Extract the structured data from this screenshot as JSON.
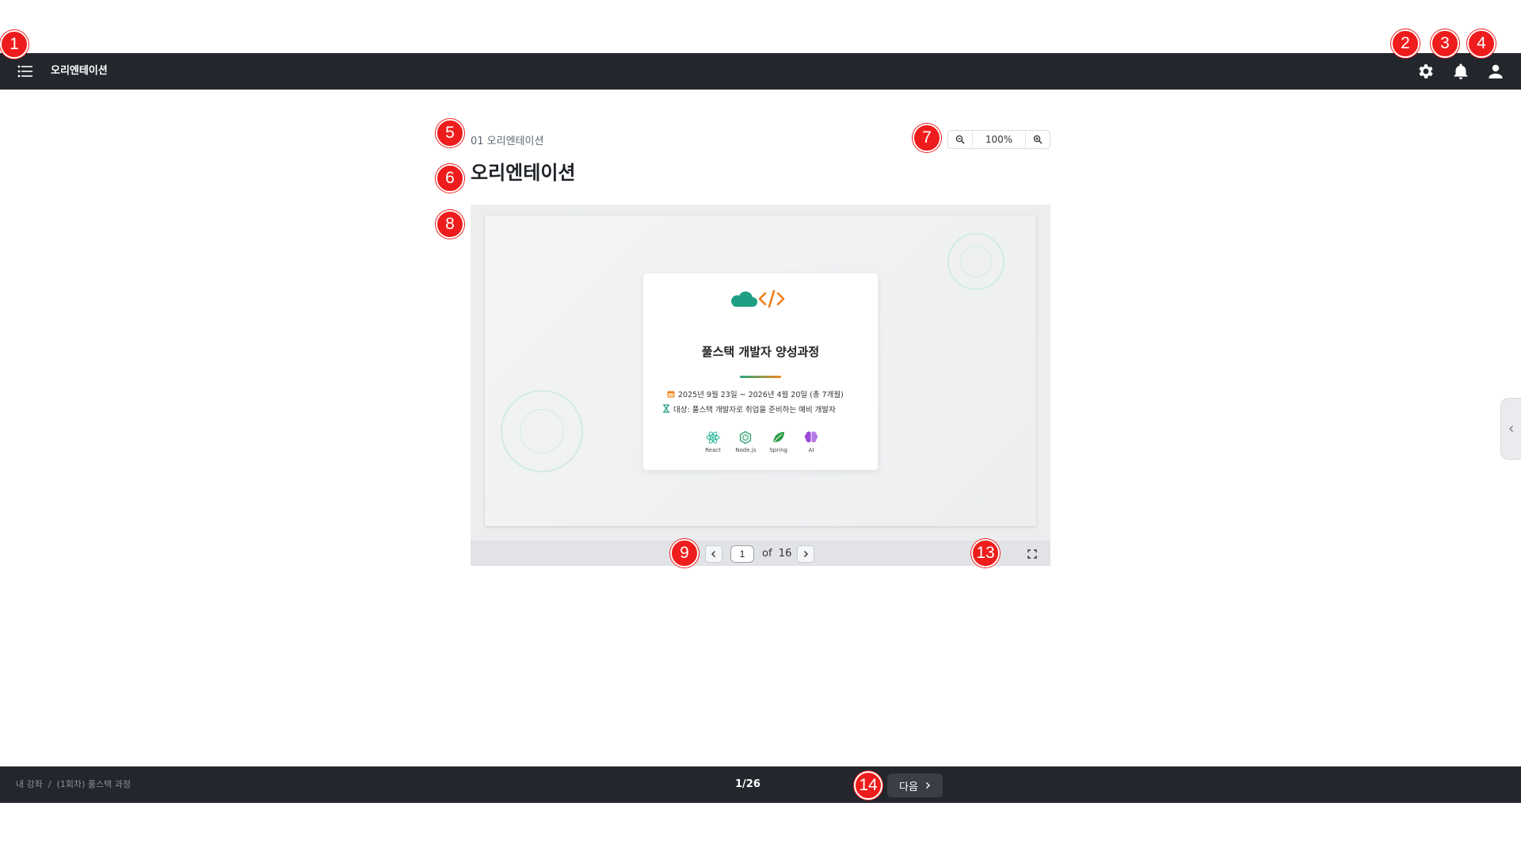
{
  "header": {
    "title": "오리엔테이션",
    "icons": [
      "menu-icon",
      "gear-icon",
      "bell-icon",
      "user-icon"
    ]
  },
  "lesson": {
    "subtitle": "01 오리엔테이션",
    "title": "오리엔테이션"
  },
  "zoom": {
    "value": "100%",
    "icons": [
      "zoom-out-icon",
      "zoom-in-icon"
    ]
  },
  "slide": {
    "title": "풀스택 개발자 양성과정",
    "period": "2025년 9월 23일 ~ 2026년 4월 20일 (총 7개월)",
    "target": "대상: 풀스택 개발자로 취업을 준비하는 예비 개발자",
    "techs": [
      {
        "label": "React",
        "icon": "react-icon"
      },
      {
        "label": "Node.js",
        "icon": "nodejs-icon"
      },
      {
        "label": "Spring",
        "icon": "spring-leaf-icon"
      },
      {
        "label": "AI",
        "icon": "brain-icon"
      }
    ],
    "colors": {
      "teal": "#1f9e83",
      "orange": "#f07f1a",
      "green": "#2e9c48",
      "purple": "#9a4ad6"
    }
  },
  "pager": {
    "current": "1",
    "of_label": "of",
    "total": "16"
  },
  "footer": {
    "breadcrumb": "내 강좌  /  (1회차) 풀스택 과정",
    "progress": "1/26",
    "next_label": "다음"
  },
  "markers": [
    "1",
    "2",
    "3",
    "4",
    "5",
    "6",
    "7",
    "8",
    "9",
    "13",
    "14"
  ],
  "colors": {
    "bar": "#23272d",
    "marker": "#ee1c1c"
  }
}
